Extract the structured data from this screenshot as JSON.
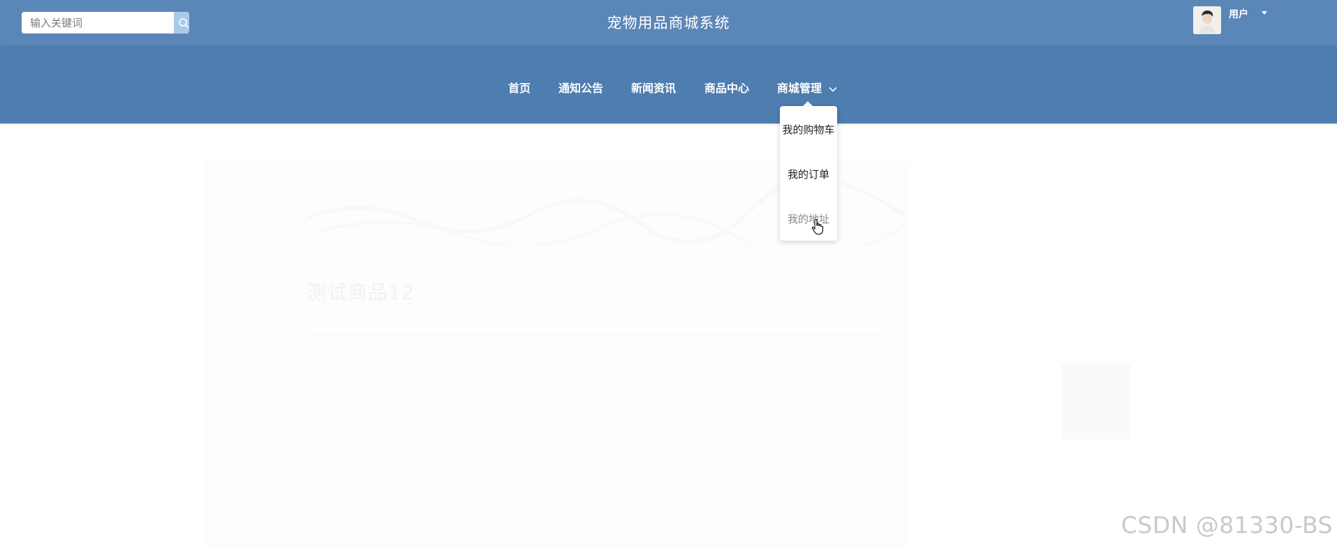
{
  "header": {
    "search_placeholder": "输入关键词",
    "title": "宠物用品商城系统",
    "user_label": "用户"
  },
  "nav": {
    "items": [
      {
        "label": "首页"
      },
      {
        "label": "通知公告"
      },
      {
        "label": "新闻资讯"
      },
      {
        "label": "商品中心"
      },
      {
        "label": "商城管理"
      }
    ]
  },
  "dropdown": {
    "items": [
      {
        "label": "我的购物车"
      },
      {
        "label": "我的订单"
      },
      {
        "label": "我的地址"
      }
    ],
    "hovered_index": 2
  },
  "background": {
    "product_title": "测试商品12"
  },
  "watermark": "CSDN @81330-BS",
  "colors": {
    "topbar": "#5b86b8",
    "navbar": "#4e7db0",
    "search_button": "#a9cbe9"
  }
}
